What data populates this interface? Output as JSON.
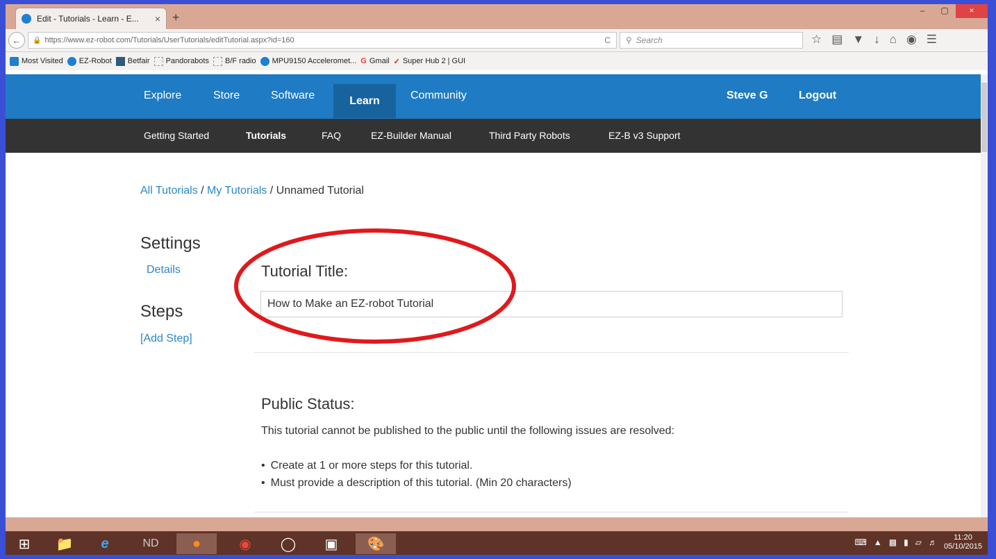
{
  "browser": {
    "tab_title": "Edit - Tutorials - Learn - E...",
    "tab_close": "×",
    "new_tab": "+",
    "window_controls": [
      "–",
      "▢",
      "×"
    ],
    "url": "https://www.ez-robot.com/Tutorials/UserTutorials/editTutorial.aspx?id=160",
    "search_placeholder": "Search",
    "reload_glyph": "C",
    "back_glyph": "←",
    "toolbar_icons": [
      "bookmark-star-icon",
      "reading-list-icon",
      "pocket-icon",
      "download-icon",
      "home-icon",
      "chat-icon",
      "menu-icon"
    ],
    "bookmarks": [
      {
        "label": "Most Visited",
        "icon": "bookmark-icon",
        "color": "#1f7fd0"
      },
      {
        "label": "EZ-Robot",
        "icon": "ezrobot-icon",
        "color": "#1f7fd0"
      },
      {
        "label": "Betfair",
        "icon": "betfair-icon",
        "color": "#2f5a7a"
      },
      {
        "label": "Pandorabots",
        "icon": "page-icon",
        "color": "#999999"
      },
      {
        "label": "B/F radio",
        "icon": "page-icon",
        "color": "#999999"
      },
      {
        "label": "MPU9150 Acceleromet...",
        "icon": "ezrobot-icon",
        "color": "#1f7fd0"
      },
      {
        "label": "Gmail",
        "icon": "google-icon",
        "color": "#e04343"
      },
      {
        "label": "Super Hub 2 | GUI",
        "icon": "check-icon",
        "color": "#d01f1f"
      }
    ]
  },
  "site": {
    "main_nav": [
      "Explore",
      "Store",
      "Software",
      "Learn",
      "Community"
    ],
    "active_main": "Learn",
    "user_name": "Steve G",
    "logout": "Logout",
    "sub_nav": [
      "Getting Started",
      "Tutorials",
      "FAQ",
      "EZ-Builder Manual",
      "Third Party Robots",
      "EZ-B v3 Support"
    ],
    "active_sub": "Tutorials",
    "accent": "#1f7bc4",
    "subnav_bg": "#333333"
  },
  "breadcrumb": {
    "all": "All Tutorials",
    "sep1": " / ",
    "mine": "My Tutorials",
    "sep2": " / ",
    "current": "Unnamed Tutorial"
  },
  "sidebar": {
    "settings_heading": "Settings",
    "details_link": "Details",
    "steps_heading": "Steps",
    "add_step_link": "[Add Step]"
  },
  "form": {
    "title_label": "Tutorial Title:",
    "title_value": "How to Make an EZ-robot Tutorial",
    "annotation_color": "#e0191c"
  },
  "public_status": {
    "heading": "Public Status:",
    "message": "This tutorial cannot be published to the public until the following issues are resolved:",
    "issues": [
      "Create at 1 or more steps for this tutorial.",
      "Must provide a description of this tutorial. (Min 20 characters)"
    ]
  },
  "taskbar": {
    "apps": [
      "start-icon",
      "file-explorer-icon",
      "internet-explorer-icon",
      "nd-icon",
      "firefox-icon",
      "headphones-app-icon",
      "media-app-icon",
      "monitor-app-icon",
      "paint-app-icon"
    ],
    "active_apps": [
      "firefox-icon",
      "paint-app-icon"
    ],
    "time": "11:20",
    "date": "05/10/2015"
  }
}
